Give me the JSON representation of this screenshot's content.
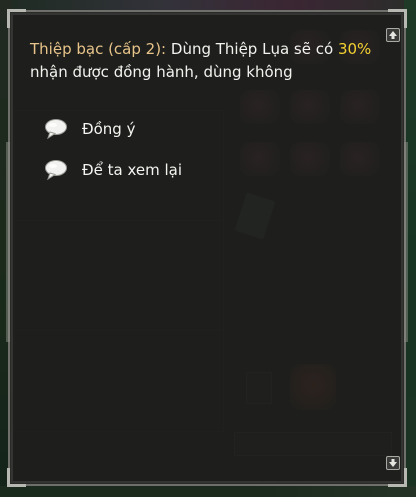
{
  "dialog": {
    "speaker": "Thiệp bạc (cấp 2):",
    "message_before": " Dùng Thiệp Lụa sẽ có ",
    "percent": "30%",
    "message_after": " nhận được đồng hành, dùng không",
    "options": [
      {
        "label": "Đồng ý",
        "icon": "speech-bubble-icon"
      },
      {
        "label": "Để ta xem lại",
        "icon": "speech-bubble-icon"
      }
    ],
    "scroll_up_icon": "scroll-up-icon",
    "scroll_down_icon": "scroll-down-icon"
  },
  "colors": {
    "speaker": "#e8c48a",
    "percent": "#f2d030",
    "text": "#f2f2ee",
    "panel_border": "#6f706b"
  }
}
